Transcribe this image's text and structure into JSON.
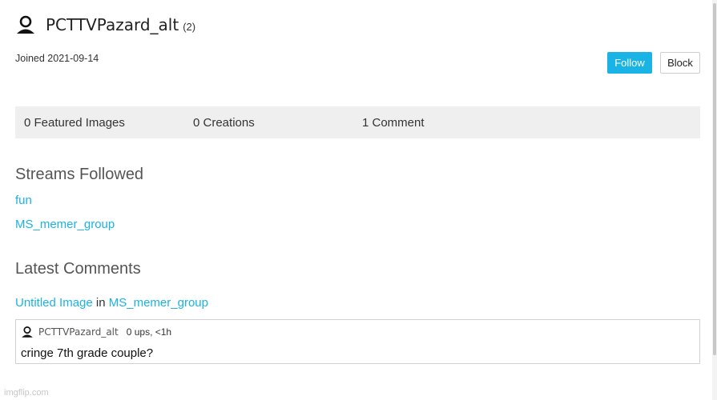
{
  "profile": {
    "username": "PCTTVPazard_alt",
    "reputation": "(2)",
    "joined": "Joined 2021-09-14",
    "follow_label": "Follow",
    "block_label": "Block"
  },
  "stats": {
    "featured": "0 Featured Images",
    "creations": "0 Creations",
    "comments": "1 Comment"
  },
  "streams": {
    "title": "Streams Followed",
    "items": [
      "fun",
      "MS_memer_group"
    ]
  },
  "latest_comments": {
    "title": "Latest Comments",
    "items": [
      {
        "image_title": "Untitled Image",
        "in_label": "in",
        "stream": "MS_memer_group",
        "author": "PCTTVPazard_alt",
        "meta": "0 ups, <1h",
        "text": "cringe 7th grade couple?"
      }
    ]
  },
  "footer": {
    "watermark": "imgflip.com"
  },
  "colors": {
    "accent": "#1ab3e6",
    "stats_bg": "#efefef"
  },
  "icons": {
    "user": "user-icon"
  }
}
